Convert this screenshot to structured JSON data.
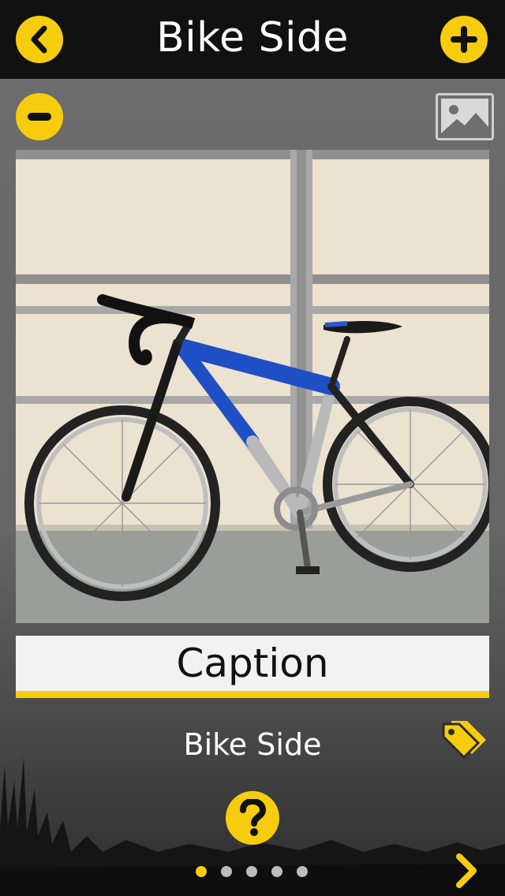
{
  "header": {
    "title": "Bike Side",
    "back_icon": "chevron-left-icon",
    "add_icon": "plus-icon"
  },
  "toolbar": {
    "remove_icon": "minus-icon",
    "gallery_icon": "image-icon"
  },
  "caption": {
    "label": "Caption",
    "value": "Bike Side"
  },
  "actions": {
    "tag_icon": "tag-icon",
    "help_icon": "question-icon",
    "next_icon": "chevron-right-icon"
  },
  "pager": {
    "count": 5,
    "active_index": 0
  },
  "colors": {
    "accent": "#f5cd0e",
    "header_bg": "#111111",
    "body_bg": "#6b6b6b"
  }
}
